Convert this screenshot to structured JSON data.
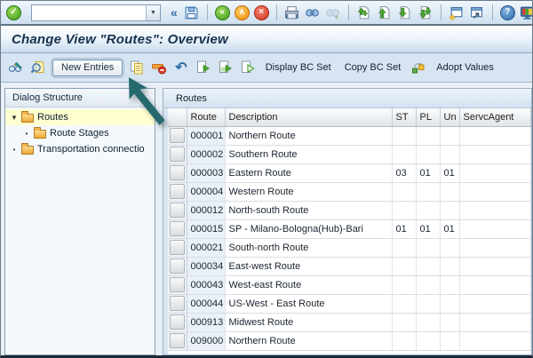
{
  "title": "Change View \"Routes\": Overview",
  "toolbar": {
    "command_value": "",
    "icons": [
      "enter",
      "command-combo",
      "dropdown",
      "collapse",
      "save",
      "back",
      "exit",
      "cancel",
      "print",
      "find",
      "find-next",
      "first-page",
      "previous-page",
      "next-page",
      "last-page",
      "new-session",
      "generate-shortcut",
      "help",
      "customize-layout"
    ]
  },
  "glyphs": {
    "enter": "✓",
    "dropdown": "▼",
    "collapse": "«",
    "back": "«",
    "exit": "∧",
    "cancel": "×",
    "help": "?",
    "undo": "↶",
    "expander": "▼",
    "bullet": "•"
  },
  "app_toolbar": {
    "icons": [
      "display-change",
      "choose",
      "copy",
      "delete-row",
      "undo",
      "select-all",
      "select-block",
      "deselect-all",
      "bc-set"
    ],
    "new_entries": "New Entries",
    "display_bc_set": "Display BC Set",
    "copy_bc_set": "Copy BC Set",
    "adopt_values": "Adopt Values"
  },
  "sidebar": {
    "header": "Dialog Structure",
    "items": [
      {
        "label": "Routes",
        "level": 0,
        "expanded": true,
        "selected": true
      },
      {
        "label": "Route Stages",
        "level": 1,
        "expanded": false,
        "selected": false
      },
      {
        "label": "Transportation connectio",
        "level": 0,
        "expanded": false,
        "selected": false
      }
    ]
  },
  "table": {
    "caption": "Routes",
    "columns": [
      "Route",
      "Description",
      "ST",
      "PL",
      "Un",
      "ServcAgent"
    ],
    "rows": [
      [
        "000001",
        "Northern Route",
        "",
        "",
        "",
        ""
      ],
      [
        "000002",
        "Southern Route",
        "",
        "",
        "",
        ""
      ],
      [
        "000003",
        "Eastern Route",
        "03",
        "01",
        "01",
        ""
      ],
      [
        "000004",
        "Western Route",
        "",
        "",
        "",
        ""
      ],
      [
        "000012",
        "North-south Route",
        "",
        "",
        "",
        ""
      ],
      [
        "000015",
        "SP - Milano-Bologna(Hub)-Bari",
        "01",
        "01",
        "01",
        ""
      ],
      [
        "000021",
        "South-north Route",
        "",
        "",
        "",
        ""
      ],
      [
        "000034",
        "East-west Route",
        "",
        "",
        "",
        ""
      ],
      [
        "000043",
        "West-east Route",
        "",
        "",
        "",
        ""
      ],
      [
        "000044",
        "US-West - East Route",
        "",
        "",
        "",
        ""
      ],
      [
        "000913",
        "Midwest Route",
        "",
        "",
        "",
        ""
      ],
      [
        "009000",
        "Northern Route",
        "",
        "",
        "",
        ""
      ]
    ]
  },
  "colors": {
    "annotation_arrow": "#266a6e",
    "tree_selection": "#ffffd0",
    "toolbar_bg": "#d7e5f2",
    "titlebar_text": "#16324e"
  }
}
